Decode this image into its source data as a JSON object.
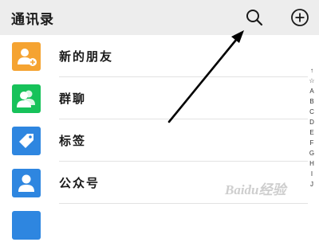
{
  "header": {
    "title": "通讯录",
    "search_icon": "search-icon",
    "add_icon": "plus-circle-icon"
  },
  "contacts": [
    {
      "label": "新的朋友",
      "icon": "add-friend-icon",
      "color": "#f5a331"
    },
    {
      "label": "群聊",
      "icon": "group-chat-icon",
      "color": "#17c25a"
    },
    {
      "label": "标签",
      "icon": "tag-icon",
      "color": "#2e86e0"
    },
    {
      "label": "公众号",
      "icon": "official-account-icon",
      "color": "#2e86e0"
    }
  ],
  "index_bar": [
    "↑",
    "☆",
    "A",
    "B",
    "C",
    "D",
    "E",
    "F",
    "G",
    "H",
    "I",
    "J"
  ],
  "watermark": "Baidu经验"
}
